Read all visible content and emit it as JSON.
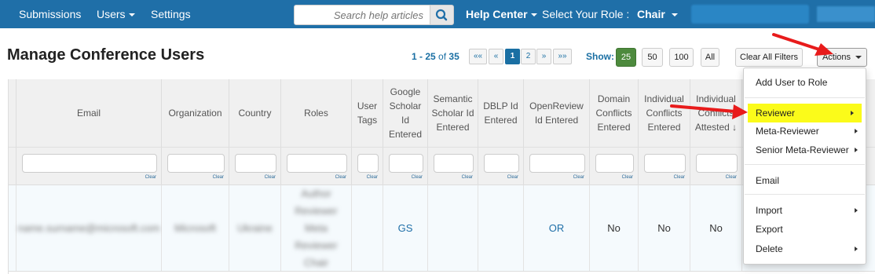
{
  "nav": {
    "submissions": "Submissions",
    "users": "Users",
    "settings": "Settings",
    "search_placeholder": "Search help articles",
    "help_center": "Help Center",
    "select_role_label": "Select Your Role :",
    "role": "Chair"
  },
  "page": {
    "title": "Manage Conference Users",
    "pager": {
      "range": "1 - 25",
      "of": "of",
      "total": "35",
      "first": "««",
      "prev": "«",
      "pages": [
        "1",
        "2"
      ],
      "next": "»",
      "last": "»»"
    },
    "show_label": "Show:",
    "page_sizes": [
      "25",
      "50",
      "100",
      "All"
    ],
    "clear_filters": "Clear All Filters",
    "actions": "Actions"
  },
  "table": {
    "columns": [
      "Email",
      "Organization",
      "Country",
      "Roles",
      "User Tags",
      "Google Scholar Id Entered",
      "Semantic Scholar Id Entered",
      "DBLP Id Entered",
      "OpenReview Id Entered",
      "Domain Conflicts Entered",
      "Individual Conflicts Entered",
      "Individual Conflicts Attested ↓"
    ],
    "clear_label": "Clear",
    "row": {
      "email": "name.surname@microsoft.com",
      "organization": "Microsoft",
      "country": "Ukraine",
      "roles": "Author Reviewer Meta Reviewer Chair",
      "user_tags": "",
      "google_scholar": "GS",
      "semantic_scholar": "",
      "dblp": "",
      "openreview": "OR",
      "domain_conflicts": "No",
      "individual_conflicts": "No",
      "individual_attested": "No"
    }
  },
  "actions_menu": {
    "add_user_to_role": "Add User to Role",
    "reviewer": "Reviewer",
    "meta_reviewer": "Meta-Reviewer",
    "senior_meta_reviewer": "Senior Meta-Reviewer",
    "email": "Email",
    "import": "Import",
    "export": "Export",
    "delete": "Delete"
  },
  "colors": {
    "navbar": "#1f6fa8",
    "highlight": "#fbfb1a",
    "arrow": "#e81b1b",
    "active_page_size": "#4d8a3d"
  }
}
